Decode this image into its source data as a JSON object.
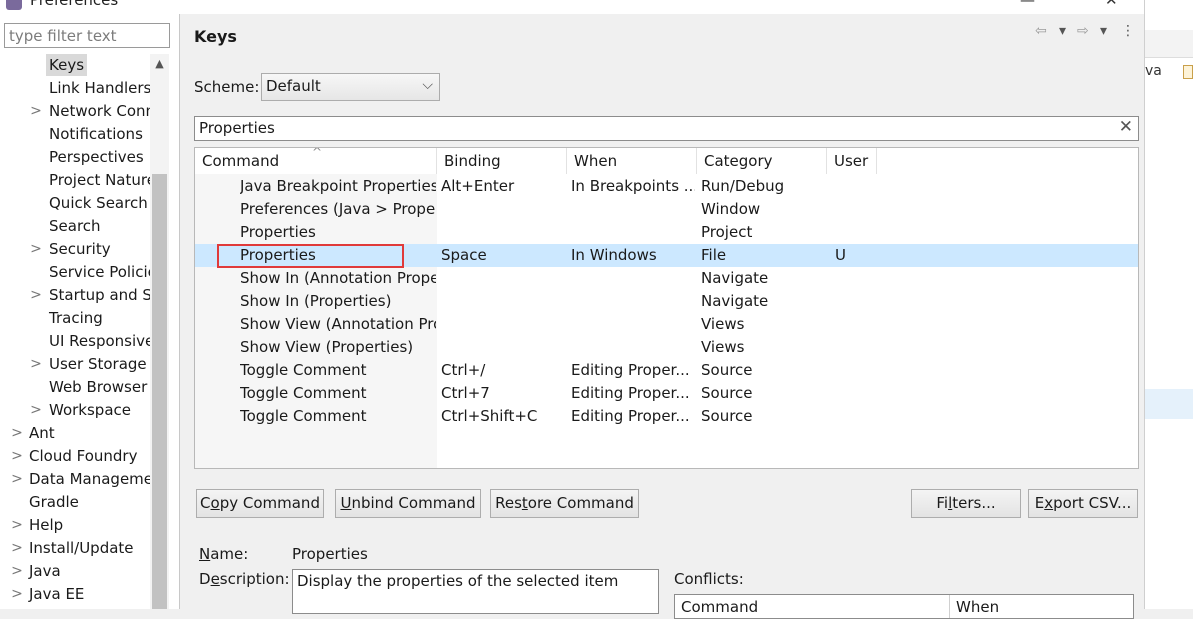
{
  "window": {
    "title": "Preferences",
    "minimize": "—",
    "close": "✕"
  },
  "filter": {
    "placeholder": "type filter text"
  },
  "tree": [
    {
      "label": "Keys",
      "arrow": "",
      "selected": true
    },
    {
      "label": "Link Handlers",
      "arrow": ""
    },
    {
      "label": "Network Connections",
      "arrow": ">"
    },
    {
      "label": "Notifications",
      "arrow": ""
    },
    {
      "label": "Perspectives",
      "arrow": ""
    },
    {
      "label": "Project Natures",
      "arrow": ""
    },
    {
      "label": "Quick Search",
      "arrow": ""
    },
    {
      "label": "Search",
      "arrow": ""
    },
    {
      "label": "Security",
      "arrow": ">"
    },
    {
      "label": "Service Policies",
      "arrow": ""
    },
    {
      "label": "Startup and Shutdown",
      "arrow": ">"
    },
    {
      "label": "Tracing",
      "arrow": ""
    },
    {
      "label": "UI Responsiveness",
      "arrow": ""
    },
    {
      "label": "User Storage",
      "arrow": ">"
    },
    {
      "label": "Web Browser",
      "arrow": ""
    },
    {
      "label": "Workspace",
      "arrow": ">"
    },
    {
      "label": "Ant",
      "arrow": ">"
    },
    {
      "label": "Cloud Foundry",
      "arrow": ">"
    },
    {
      "label": "Data Management",
      "arrow": ">"
    },
    {
      "label": "Gradle",
      "arrow": ""
    },
    {
      "label": "Help",
      "arrow": ">"
    },
    {
      "label": "Install/Update",
      "arrow": ">"
    },
    {
      "label": "Java",
      "arrow": ">"
    },
    {
      "label": "Java EE",
      "arrow": ">"
    }
  ],
  "page": {
    "title": "Keys",
    "nav_icons": [
      "⇦",
      "▾",
      "⇨",
      "▾",
      "⋮"
    ],
    "scheme_label": "Scheme:",
    "scheme_value": "Default",
    "search_value": "Properties",
    "clear_glyph": "✕"
  },
  "table": {
    "columns": [
      "Command",
      "Binding",
      "When",
      "Category",
      "User"
    ],
    "sort_arrow": "^",
    "rows": [
      {
        "command": "Java Breakpoint Properties",
        "binding": "Alt+Enter",
        "when": "In Breakpoints ...",
        "category": "Run/Debug",
        "user": ""
      },
      {
        "command": "Preferences (Java > Properties)",
        "binding": "",
        "when": "",
        "category": "Window",
        "user": ""
      },
      {
        "command": "Properties",
        "binding": "",
        "when": "",
        "category": "Project",
        "user": ""
      },
      {
        "command": "Properties",
        "binding": "Space",
        "when": "In Windows",
        "category": "File",
        "user": "U"
      },
      {
        "command": "Show In (Annotation Properties)",
        "binding": "",
        "when": "",
        "category": "Navigate",
        "user": ""
      },
      {
        "command": "Show In (Properties)",
        "binding": "",
        "when": "",
        "category": "Navigate",
        "user": ""
      },
      {
        "command": "Show View (Annotation Properties)",
        "binding": "",
        "when": "",
        "category": "Views",
        "user": ""
      },
      {
        "command": "Show View (Properties)",
        "binding": "",
        "when": "",
        "category": "Views",
        "user": ""
      },
      {
        "command": "Toggle Comment",
        "binding": "Ctrl+/",
        "when": "Editing Proper...",
        "category": "Source",
        "user": ""
      },
      {
        "command": "Toggle Comment",
        "binding": "Ctrl+7",
        "when": "Editing Proper...",
        "category": "Source",
        "user": ""
      },
      {
        "command": "Toggle Comment",
        "binding": "Ctrl+Shift+C",
        "when": "Editing Proper...",
        "category": "Source",
        "user": ""
      }
    ],
    "selected_row": 3
  },
  "buttons": {
    "copy_pre": "C",
    "copy_u": "o",
    "copy_post": "py Command",
    "unbind_pre": "",
    "unbind_u": "U",
    "unbind_post": "nbind Command",
    "restore_pre": "Res",
    "restore_u": "t",
    "restore_post": "ore Command",
    "filters_pre": "Fi",
    "filters_u": "l",
    "filters_post": "ters...",
    "export_pre": "E",
    "export_u": "x",
    "export_post": "port CSV..."
  },
  "details": {
    "name_pre": "",
    "name_u": "N",
    "name_post": "ame:",
    "name_value": "Properties",
    "desc_pre": "D",
    "desc_u": "e",
    "desc_post": "scription:",
    "desc_value": "Display the properties of the selected item",
    "conflicts_label": "Conflicts:",
    "conflict_columns": [
      "Command",
      "When"
    ]
  },
  "background_window": {
    "snippet": "va"
  }
}
